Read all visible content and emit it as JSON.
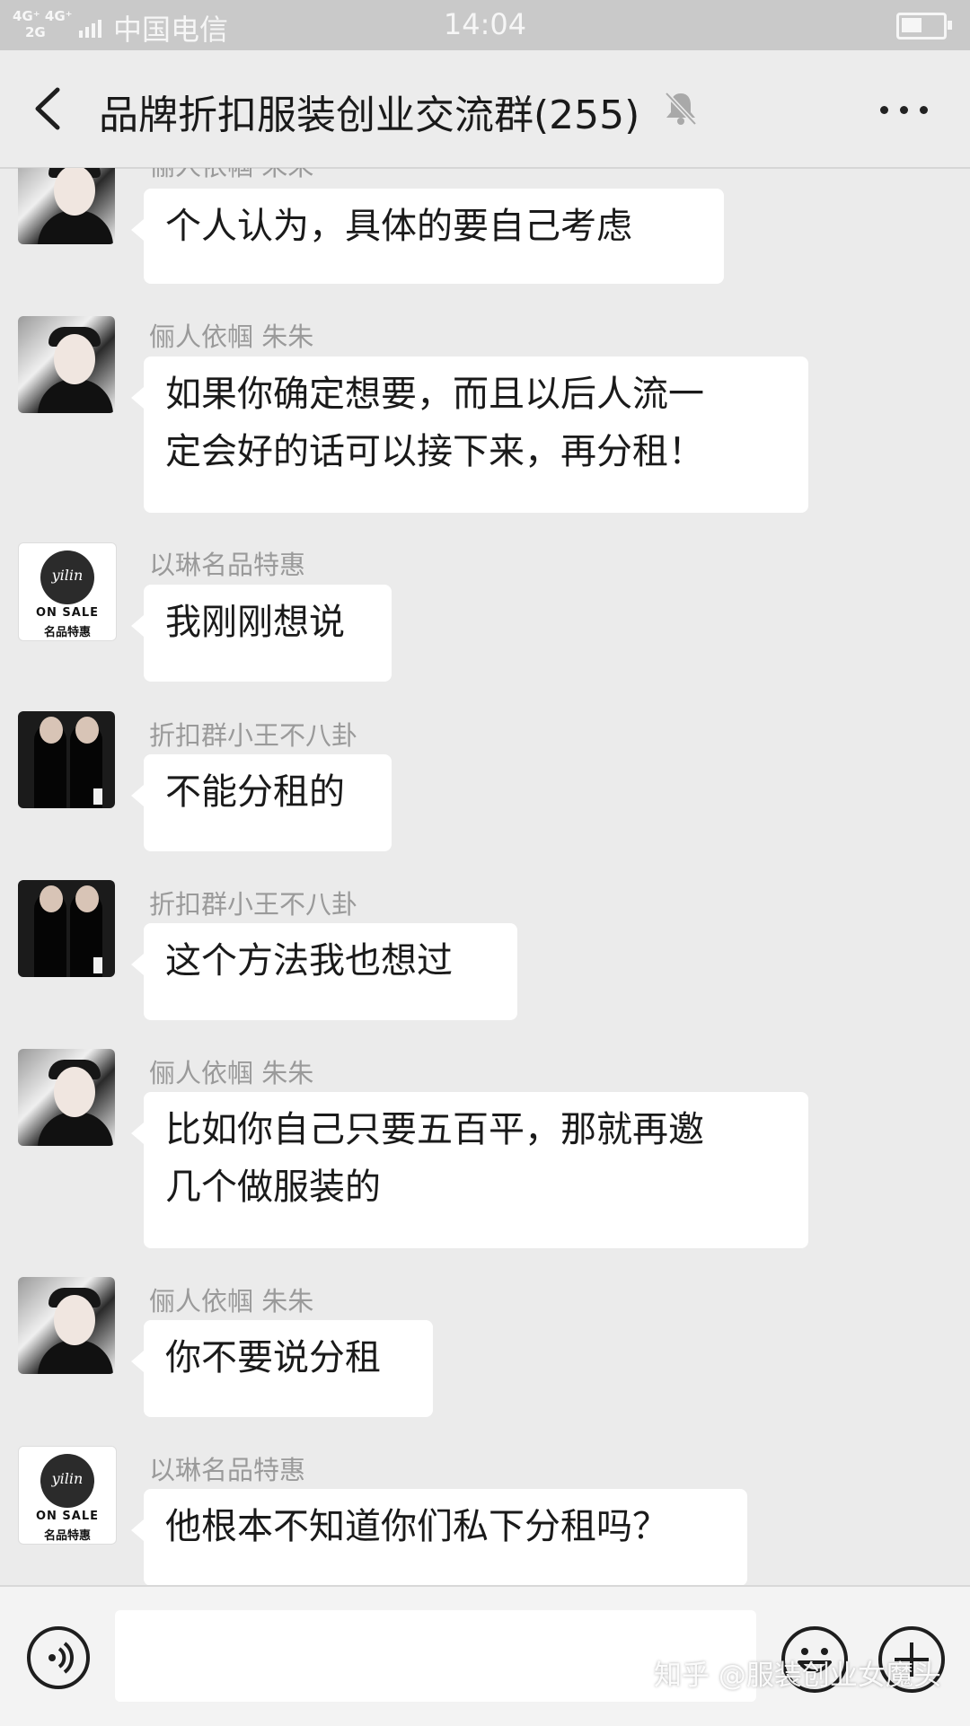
{
  "status_bar": {
    "network_top": "4G⁺ 4G⁺",
    "network_bottom": "2G",
    "carrier": "中国电信",
    "time": "14:04"
  },
  "header": {
    "title": "品牌折扣服装创业交流群(255)",
    "back_icon": "chevron-left-icon",
    "mute_icon": "bell-off-icon",
    "more_icon": "more-dots-icon"
  },
  "messages": [
    {
      "sender": "俪人依帼 朱朱",
      "avatar": "woman-photo",
      "text": "个人认为，具体的要自己考虑"
    },
    {
      "sender": "俪人依帼 朱朱",
      "avatar": "woman-photo",
      "text": "如果你确定想要，而且以后人流一\n定会好的话可以接下来，再分租！"
    },
    {
      "sender": "以琳名品特惠",
      "avatar": "yilin-logo",
      "text": "我刚刚想说"
    },
    {
      "sender": "折扣群小王不八卦",
      "avatar": "couple-photo",
      "text": "不能分租的"
    },
    {
      "sender": "折扣群小王不八卦",
      "avatar": "couple-photo",
      "text": "这个方法我也想过"
    },
    {
      "sender": "俪人依帼 朱朱",
      "avatar": "woman-photo",
      "text": "比如你自己只要五百平，那就再邀\n几个做服装的"
    },
    {
      "sender": "俪人依帼 朱朱",
      "avatar": "woman-photo",
      "text": "你不要说分租"
    },
    {
      "sender": "以琳名品特惠",
      "avatar": "yilin-logo",
      "text": "他根本不知道你们私下分租吗？"
    }
  ],
  "logo": {
    "script": "yilin",
    "line1": "ON SALE",
    "line2": "名品特惠"
  },
  "input_bar": {
    "message_value": "",
    "voice_icon": "voice-icon",
    "emoji_icon": "emoji-icon",
    "plus_icon": "plus-icon"
  },
  "watermark": "知乎 @服装创业女魔头"
}
